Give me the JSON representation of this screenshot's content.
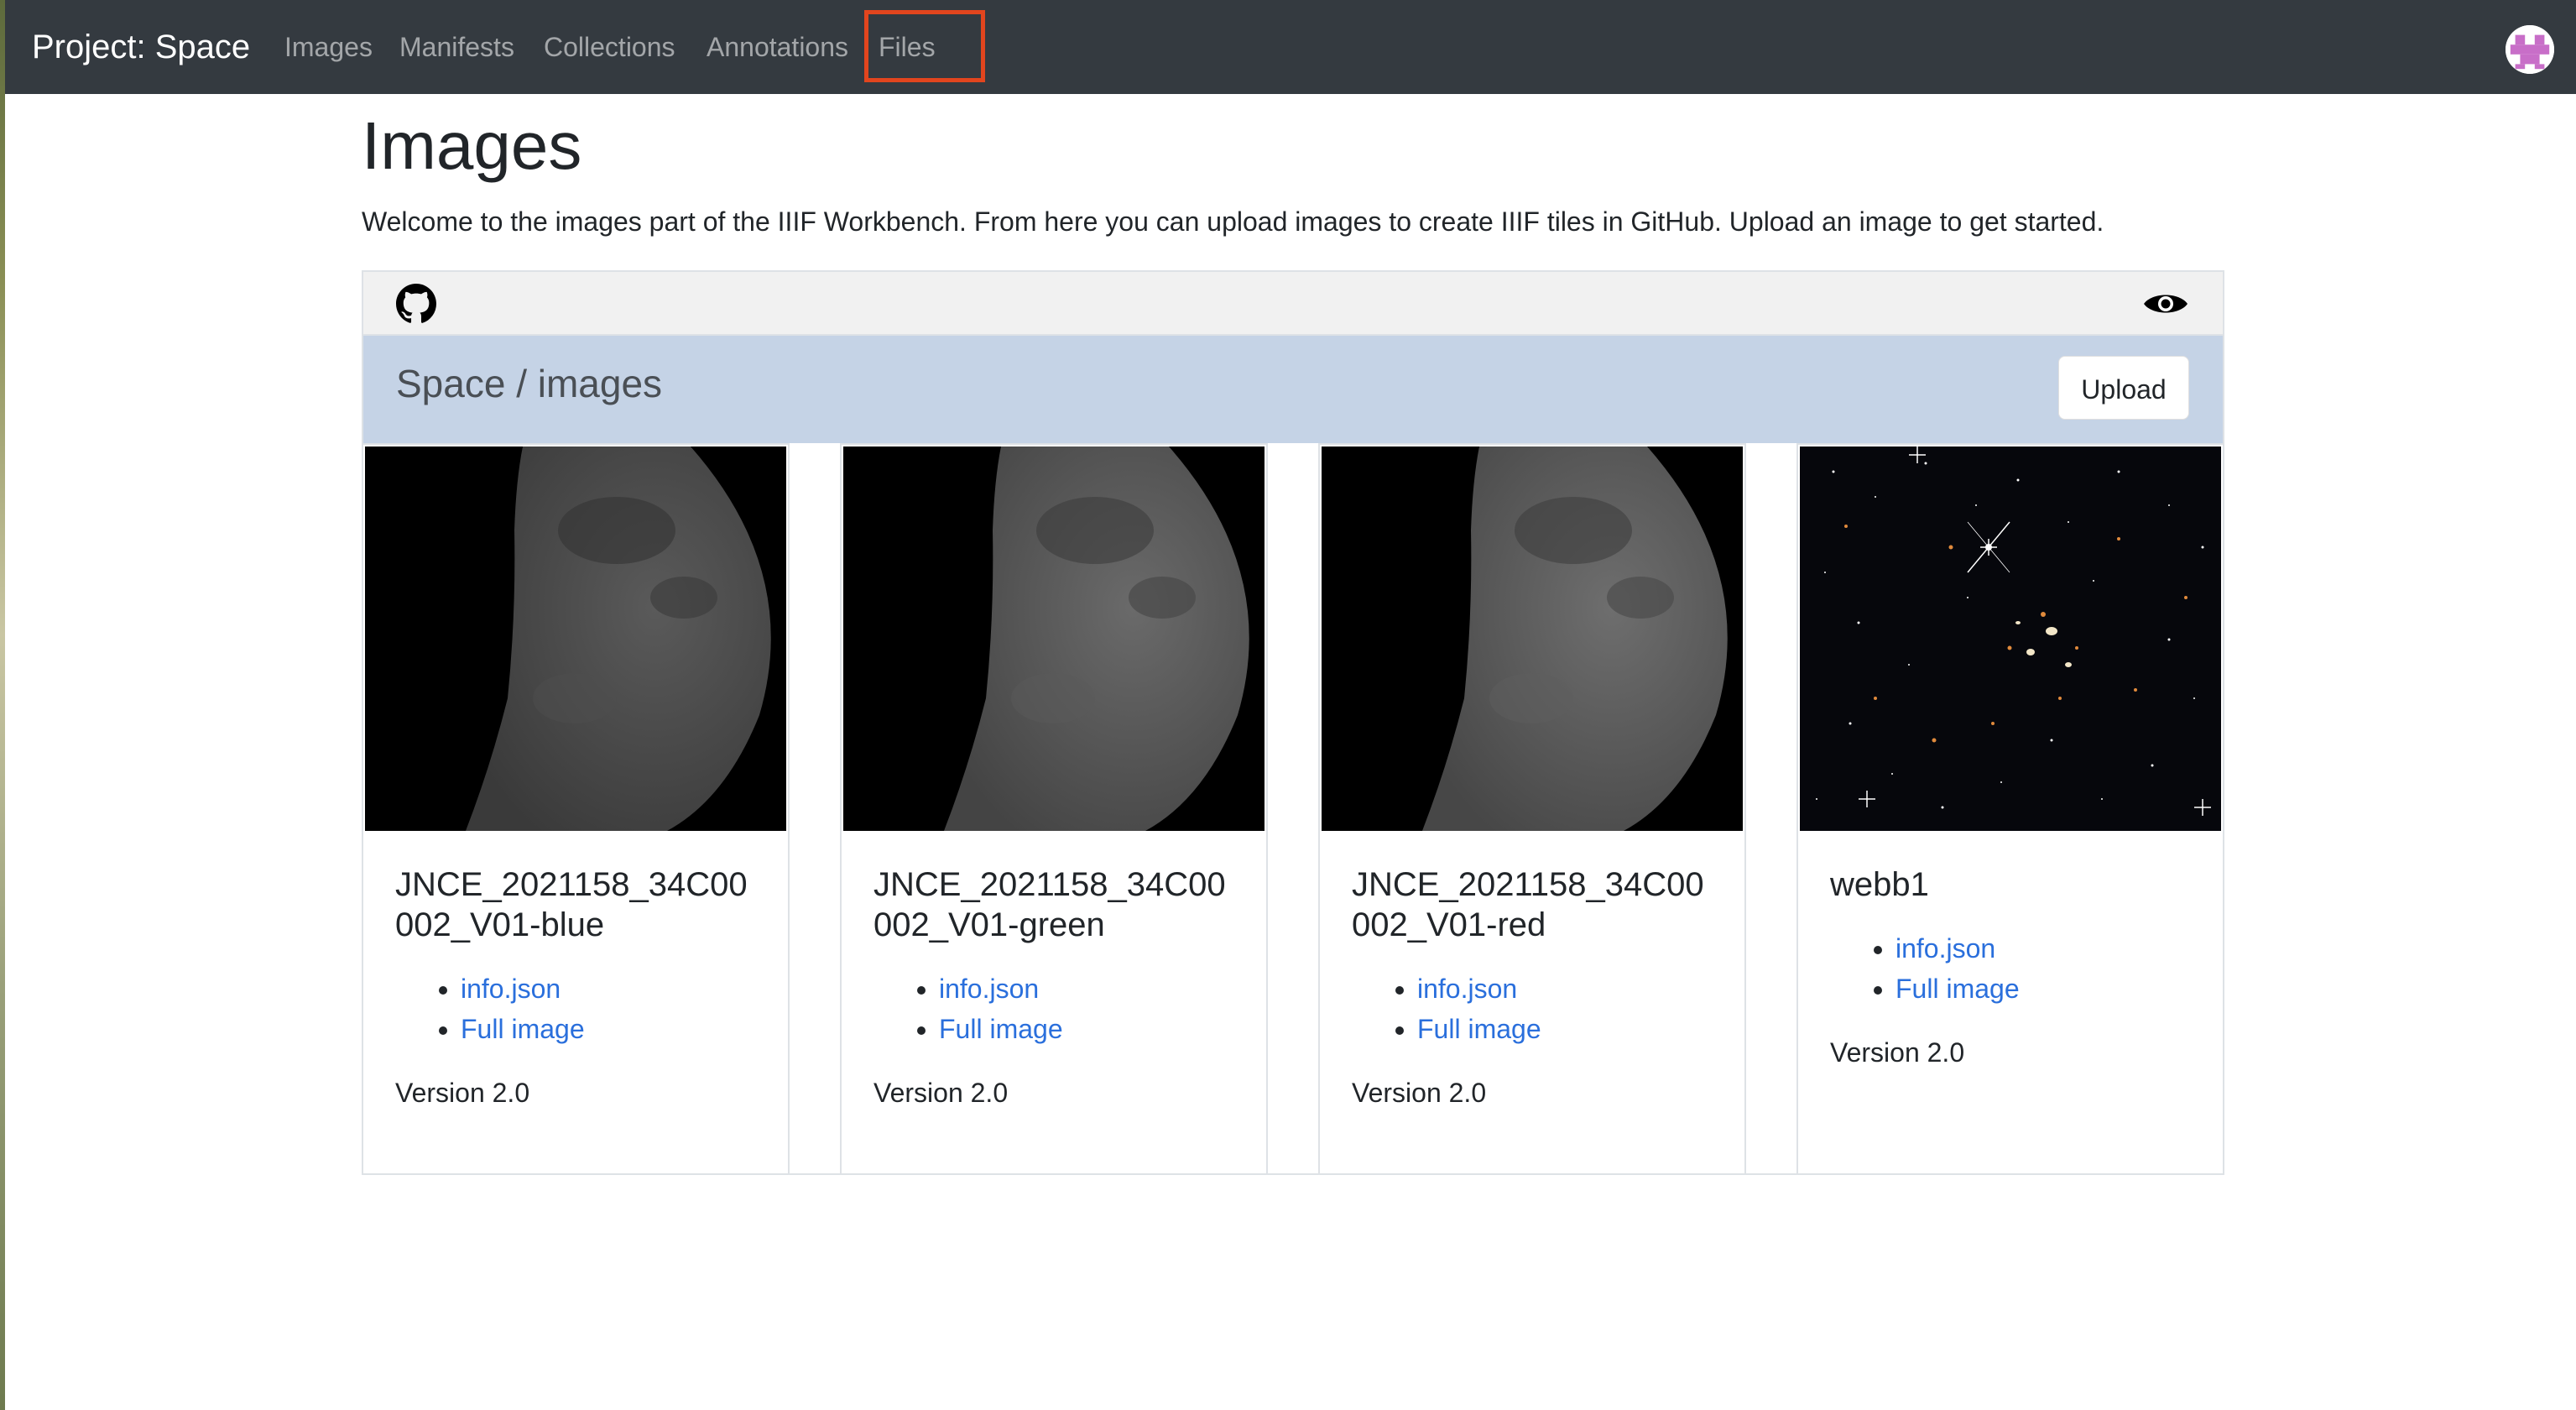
{
  "navbar": {
    "brand": "Project: Space",
    "items": [
      "Images",
      "Manifests",
      "Collections",
      "Annotations",
      "Files"
    ],
    "highlighted_item": "Files"
  },
  "page": {
    "title": "Images",
    "welcome": "Welcome to the images part of the IIIF Workbench. From here you can upload images to create IIIF tiles in GitHub. Upload an image to get started."
  },
  "toolbar": {
    "left_icon": "github-icon",
    "right_icon": "eye-icon"
  },
  "repo": {
    "path": "Space / images",
    "upload_label": "Upload"
  },
  "cards": [
    {
      "title": "JNCE_2021158_34C00002_V01-blue",
      "link_info": "info.json",
      "link_full": "Full image",
      "version": "Version 2.0"
    },
    {
      "title": "JNCE_2021158_34C00002_V01-green",
      "link_info": "info.json",
      "link_full": "Full image",
      "version": "Version 2.0"
    },
    {
      "title": "JNCE_2021158_34C00002_V01-red",
      "link_info": "info.json",
      "link_full": "Full image",
      "version": "Version 2.0"
    },
    {
      "title": "webb1",
      "link_info": "info.json",
      "link_full": "Full image",
      "version": "Version 2.0"
    }
  ],
  "colors": {
    "navbar": "#343a40",
    "link": "#2a6fdc",
    "path_bar": "#c5d3e6",
    "highlight": "#e2451e"
  }
}
